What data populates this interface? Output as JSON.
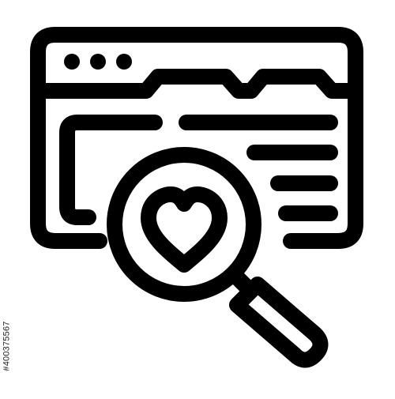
{
  "stock_id": {
    "text": "#400375567"
  },
  "icon": {
    "name": "search-favorite-website-icon",
    "stroke_color": "#000000",
    "background_color": "#ffffff"
  }
}
